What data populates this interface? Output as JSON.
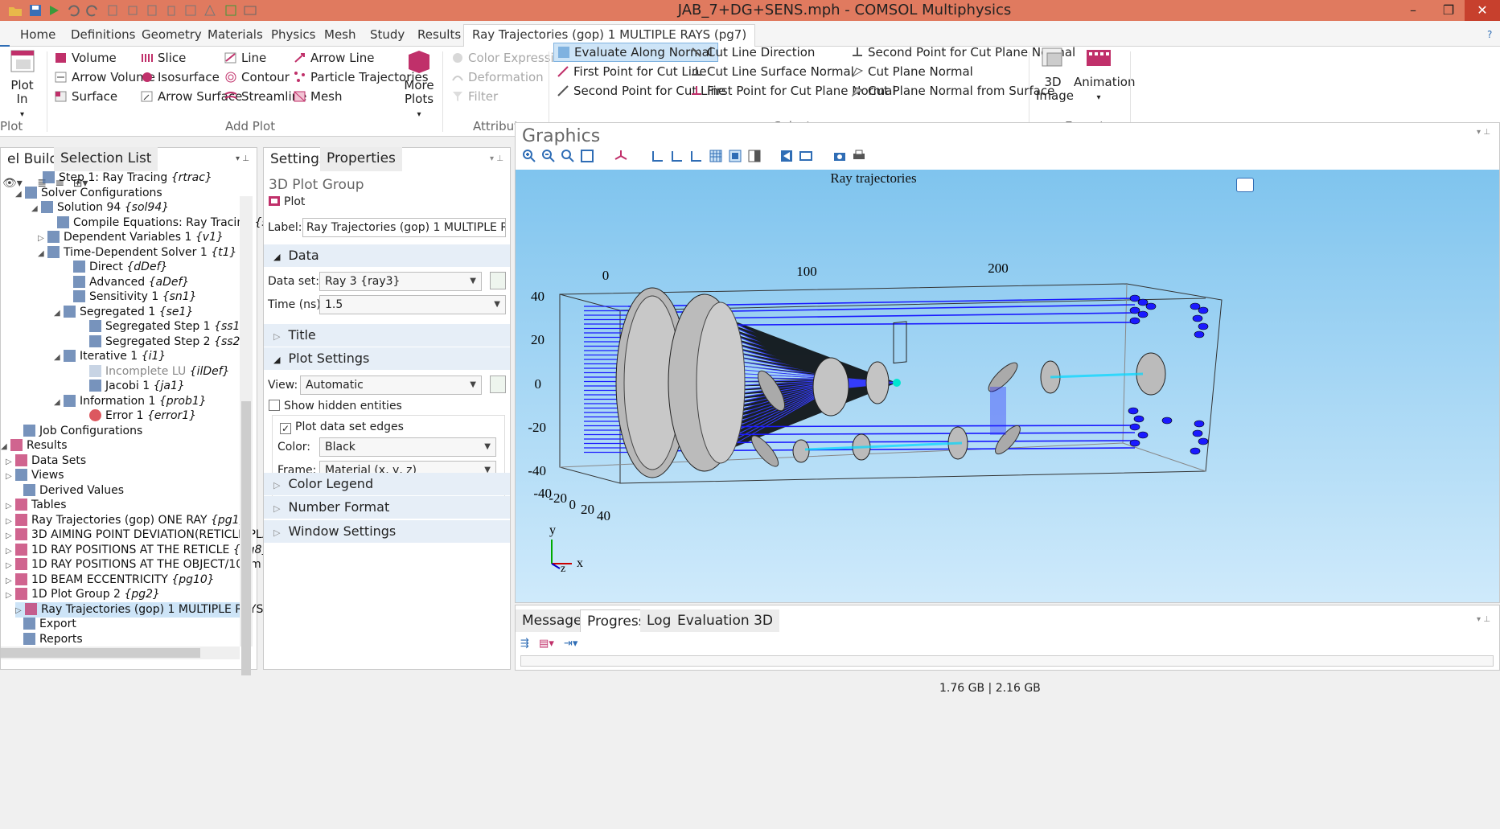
{
  "window": {
    "title": "JAB_7+DG+SENS.mph - COMSOL Multiphysics"
  },
  "ribbon_tabs": [
    "Home",
    "Definitions",
    "Geometry",
    "Materials",
    "Physics",
    "Mesh",
    "Study",
    "Results",
    "Ray Trajectories (gop) 1 MULTIPLE RAYS (pg7)"
  ],
  "ribbon": {
    "plot_in": "Plot In",
    "plot_group_label": "Plot",
    "add_plot": {
      "col1": [
        "Volume",
        "Arrow Volume",
        "Surface"
      ],
      "col2": [
        "Slice",
        "Isosurface",
        "Arrow Surface"
      ],
      "col3": [
        "Line",
        "Contour",
        "Streamline"
      ],
      "col4": [
        "Arrow Line",
        "Particle Trajectories",
        "Mesh"
      ],
      "more_plots": "More Plots",
      "label": "Add Plot"
    },
    "attributes": {
      "items": [
        "Color Expression",
        "Deformation",
        "Filter"
      ],
      "label": "Attributes"
    },
    "select": {
      "col1": [
        "Evaluate Along Normal",
        "First Point for Cut Line",
        "Second Point for Cut Line"
      ],
      "col2": [
        "Cut Line Direction",
        "Cut Line Surface Normal",
        "First Point for Cut Plane Normal"
      ],
      "col3": [
        "Second Point for Cut Plane Normal",
        "Cut Plane Normal",
        "Cut Plane Normal from Surface"
      ],
      "label": "Select"
    },
    "export": {
      "image_3d": "3D Image",
      "animation": "Animation",
      "label": "Export"
    }
  },
  "tree_panel": {
    "tabs": [
      "el Builder",
      "Selection List"
    ],
    "items": [
      {
        "text": "Step 1: Ray Tracing ",
        "tag": "{rtrac}"
      },
      {
        "text": "Solver Configurations",
        "tag": ""
      },
      {
        "text": "Solution 94 ",
        "tag": "{sol94}"
      },
      {
        "text": "Compile Equations: Ray Tracing ",
        "tag": "{st1}"
      },
      {
        "text": "Dependent Variables 1 ",
        "tag": "{v1}"
      },
      {
        "text": "Time-Dependent Solver 1 ",
        "tag": "{t1}"
      },
      {
        "text": "Direct ",
        "tag": "{dDef}"
      },
      {
        "text": "Advanced ",
        "tag": "{aDef}"
      },
      {
        "text": "Sensitivity 1 ",
        "tag": "{sn1}"
      },
      {
        "text": "Segregated 1 ",
        "tag": "{se1}"
      },
      {
        "text": "Segregated Step 1 ",
        "tag": "{ss1}"
      },
      {
        "text": "Segregated Step 2 ",
        "tag": "{ss2}"
      },
      {
        "text": "Iterative 1 ",
        "tag": "{i1}"
      },
      {
        "text": "Incomplete LU ",
        "tag": "{ilDef}"
      },
      {
        "text": "Jacobi 1 ",
        "tag": "{ja1}"
      },
      {
        "text": "Information 1 ",
        "tag": "{prob1}"
      },
      {
        "text": "Error 1 ",
        "tag": "{error1}"
      },
      {
        "text": "Job Configurations",
        "tag": ""
      },
      {
        "text": "Results",
        "tag": ""
      },
      {
        "text": "Data Sets",
        "tag": ""
      },
      {
        "text": "Views",
        "tag": ""
      },
      {
        "text": "Derived Values",
        "tag": ""
      },
      {
        "text": "Tables",
        "tag": ""
      },
      {
        "text": "Ray Trajectories (gop) ONE RAY ",
        "tag": "{pg1}"
      },
      {
        "text": "3D AIMING POINT DEVIATION(RETICLE PLANE",
        "tag": ""
      },
      {
        "text": "1D RAY POSITIONS AT THE RETICLE ",
        "tag": "{pg8}"
      },
      {
        "text": "1D RAY POSITIONS AT THE OBJECT/100m ",
        "tag": "{pg9"
      },
      {
        "text": "1D BEAM ECCENTRICITY ",
        "tag": "{pg10}"
      },
      {
        "text": "1D Plot Group 2 ",
        "tag": "{pg2}"
      },
      {
        "text": "Ray Trajectories (gop) 1 MULTIPLE RAYS ",
        "tag": "{pg7}"
      },
      {
        "text": "Export",
        "tag": ""
      },
      {
        "text": "Reports",
        "tag": ""
      }
    ]
  },
  "settings_panel": {
    "tabs": [
      "Settings",
      "Properties"
    ],
    "heading": "3D Plot Group",
    "plot_button": "Plot",
    "label_caption": "Label:",
    "label_value": "Ray Trajectories (gop) 1 MULTIPLE RAYS",
    "sections": {
      "data": "Data",
      "title": "Title",
      "plot_settings": "Plot Settings",
      "color_legend": "Color Legend",
      "number_format": "Number Format",
      "window_settings": "Window Settings"
    },
    "data_set_label": "Data set:",
    "data_set_value": "Ray 3 {ray3}",
    "time_label": "Time (ns):",
    "time_value": "1.5",
    "view_label": "View:",
    "view_value": "Automatic",
    "show_hidden": "Show hidden entities",
    "plot_edges": "Plot data set edges",
    "color_label": "Color:",
    "color_value": "Black",
    "frame_label": "Frame:",
    "frame_value": "Material  (x, y, z)"
  },
  "graphics": {
    "title": "Graphics",
    "plot_title": "Ray trajectories",
    "x_ticks": [
      "0",
      "100",
      "200"
    ],
    "y_ticks": [
      "40",
      "20",
      "0",
      "-20",
      "-40"
    ],
    "z_ticks": [
      "-40",
      "-20",
      "0",
      "20",
      "40"
    ],
    "axis_y": "y",
    "axis_z": "z",
    "axis_x": "x"
  },
  "messages_panel": {
    "tabs": [
      "Messages",
      "Progress",
      "Log",
      "Evaluation 3D"
    ]
  },
  "status": {
    "memory": "1.76 GB | 2.16 GB"
  },
  "colors": {
    "accent": "#2f6db5",
    "title_bar": "#e07a5f",
    "rays": "#1a1aff",
    "plot_icon": "#c0306a"
  }
}
